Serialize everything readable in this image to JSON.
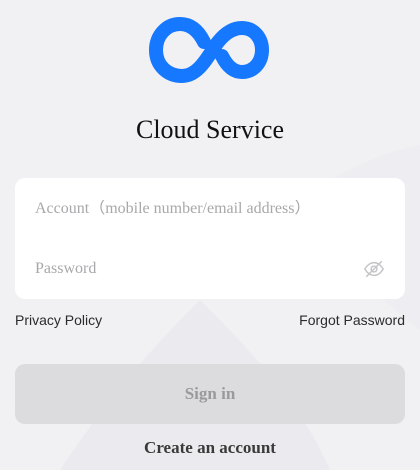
{
  "app": {
    "title": "Cloud Service"
  },
  "form": {
    "account_placeholder": "Account（mobile number/email address）",
    "account_value": "",
    "password_placeholder": "Password",
    "password_value": ""
  },
  "links": {
    "privacy": "Privacy Policy",
    "forgot": "Forgot Password"
  },
  "actions": {
    "sign_in": "Sign in",
    "create_account": "Create an account"
  },
  "icons": {
    "logo": "cloud-infinity-logo-icon",
    "password_toggle": "eye-off-icon"
  },
  "colors": {
    "brand": "#1677ff",
    "background": "#f1f1f4",
    "card": "#ffffff",
    "button_disabled": "#dcdcdf",
    "button_text_disabled": "#9a9a9d",
    "placeholder": "#a8a8ab"
  }
}
